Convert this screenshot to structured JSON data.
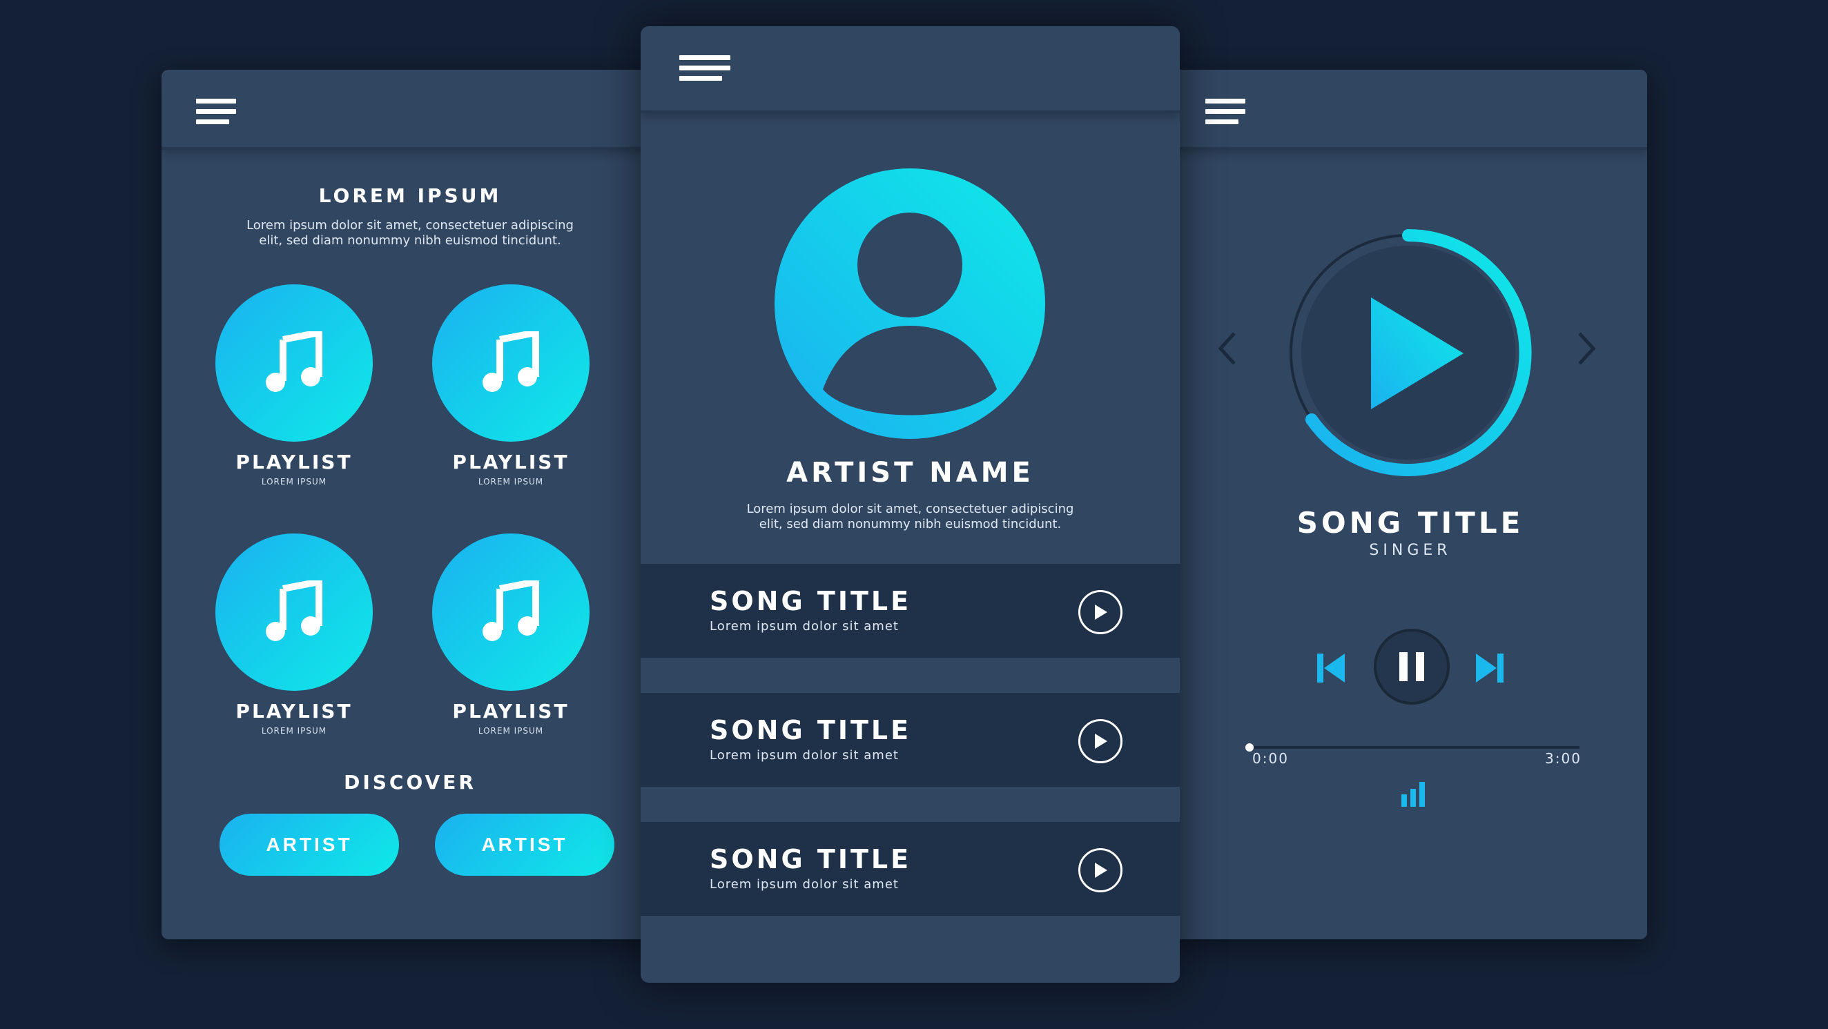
{
  "left": {
    "heading": "LOREM IPSUM",
    "description_line1": "Lorem ipsum dolor sit amet, consectetuer adipiscing",
    "description_line2": "elit, sed diam nonummy nibh euismod tincidunt.",
    "playlists": [
      {
        "label": "PLAYLIST",
        "sub": "LOREM IPSUM",
        "icon": "music-note-icon"
      },
      {
        "label": "PLAYLIST",
        "sub": "LOREM IPSUM",
        "icon": "music-note-icon"
      },
      {
        "label": "PLAYLIST",
        "sub": "LOREM IPSUM",
        "icon": "music-note-icon"
      },
      {
        "label": "PLAYLIST",
        "sub": "LOREM IPSUM",
        "icon": "music-note-icon"
      }
    ],
    "discover_heading": "DISCOVER",
    "artist_buttons": [
      "ARTIST",
      "ARTIST"
    ]
  },
  "center": {
    "artist_name": "ARTIST NAME",
    "description_line1": "Lorem ipsum dolor sit amet, consectetuer adipiscing",
    "description_line2": "elit, sed diam nonummy nibh euismod tincidunt.",
    "songs": [
      {
        "title": "SONG TITLE",
        "sub": "Lorem ipsum dolor sit amet"
      },
      {
        "title": "SONG TITLE",
        "sub": "Lorem ipsum dolor sit amet"
      },
      {
        "title": "SONG TITLE",
        "sub": "Lorem ipsum dolor sit amet"
      }
    ]
  },
  "player": {
    "song_title": "SONG TITLE",
    "singer": "SINGER",
    "time_current": "0:00",
    "time_total": "3:00",
    "progress": 0.0
  },
  "colors": {
    "background": "#142035",
    "screen": "#314661",
    "row": "#1f3049",
    "accent_start": "#1ab2ef",
    "accent_end": "#0fe9e8"
  }
}
